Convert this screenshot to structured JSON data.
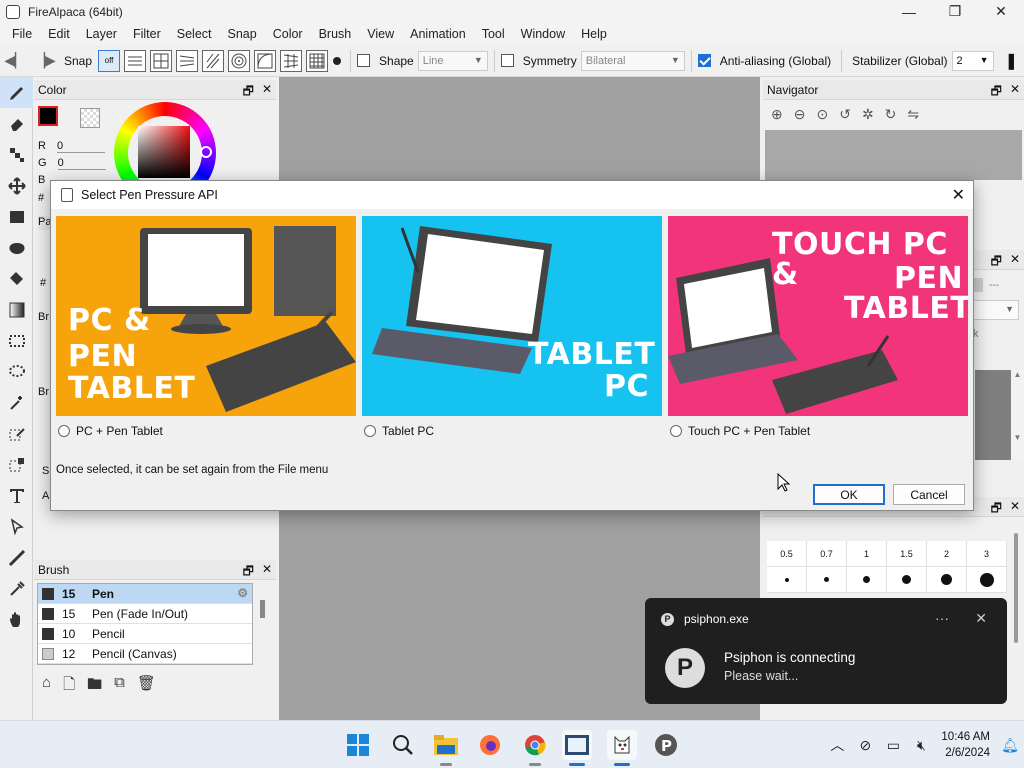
{
  "window": {
    "title": "FireAlpaca (64bit)",
    "controls": [
      "—",
      "❐",
      "✕"
    ]
  },
  "menu": [
    "File",
    "Edit",
    "Layer",
    "Filter",
    "Select",
    "Snap",
    "Color",
    "Brush",
    "View",
    "Animation",
    "Tool",
    "Window",
    "Help"
  ],
  "toolbar": {
    "snap_label": "Snap",
    "snap_off_label": "off",
    "shape_label": "Shape",
    "shape_value": "Line",
    "symmetry_label": "Symmetry",
    "symmetry_value": "Bilateral",
    "antialias_label": "Anti-aliasing (Global)",
    "stabilizer_label": "Stabilizer (Global)",
    "stabilizer_value": "2"
  },
  "color_panel": {
    "title": "Color",
    "r_label": "R",
    "r_value": "0",
    "g_label": "G",
    "g_value": "0",
    "b_label": "B",
    "hex_partial": "#0"
  },
  "partial_labels": {
    "pa": "Pa",
    "hash": "#",
    "br1": "Br",
    "br2": "Br",
    "s": "S",
    "a": "A",
    "k": "k",
    "dash": "---"
  },
  "navigator": {
    "title": "Navigator"
  },
  "brush_panel": {
    "title": "Brush",
    "items": [
      {
        "size": "15",
        "name": "Pen"
      },
      {
        "size": "15",
        "name": "Pen (Fade In/Out)"
      },
      {
        "size": "10",
        "name": "Pencil"
      },
      {
        "size": "12",
        "name": "Pencil (Canvas)"
      }
    ]
  },
  "brush_size": {
    "labels": [
      "0.5",
      "0.7",
      "1",
      "1.5",
      "2",
      "3"
    ]
  },
  "dialog": {
    "title": "Select Pen Pressure API",
    "options": [
      {
        "image_text_1": "PC &",
        "image_text_2": "PEN",
        "image_text_3": "TABLET",
        "label": "PC + Pen Tablet",
        "color": "#f7a30b"
      },
      {
        "image_text_1": "TABLET",
        "image_text_2": "PC",
        "label": "Tablet PC",
        "color": "#15c2f0"
      },
      {
        "image_text_1": "TOUCH PC &",
        "image_text_2": "PEN",
        "image_text_3": "TABLET",
        "label": "Touch PC + Pen Tablet",
        "color": "#f2357a"
      }
    ],
    "note": "Once selected, it can be set again from the File menu",
    "ok_label": "OK",
    "cancel_label": "Cancel"
  },
  "notification": {
    "app": "psiphon.exe",
    "title": "Psiphon is connecting",
    "body": "Please wait...",
    "more": "···",
    "close": "✕"
  },
  "taskbar": {
    "time": "10:46 AM",
    "date": "2/6/2024"
  },
  "colors": {
    "accent": "#1d6fd6",
    "canvas": "#a0a0a0",
    "orange": "#f7a30b",
    "cyan": "#15c2f0",
    "pink": "#f2357a"
  }
}
